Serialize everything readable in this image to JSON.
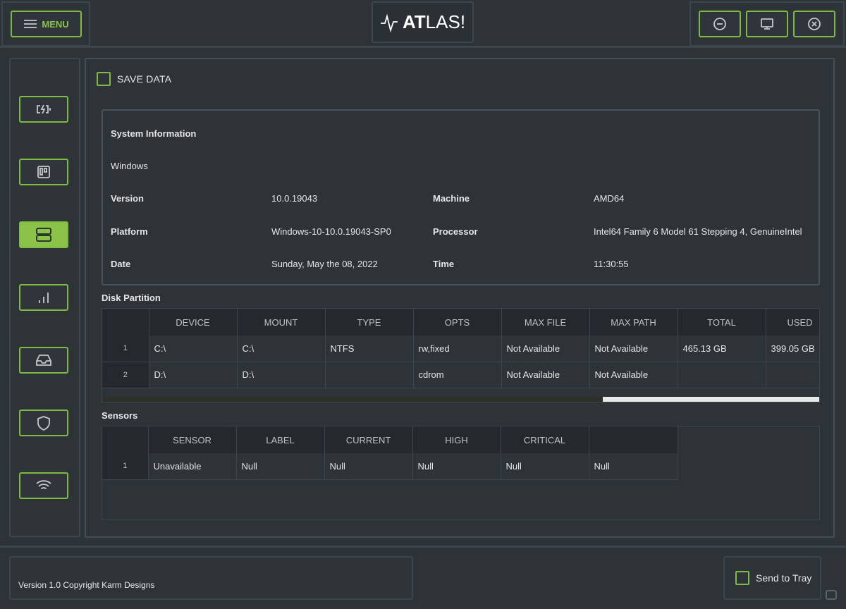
{
  "header": {
    "menu_label": "MENU",
    "logo_bold": "AT",
    "logo_rest": "LAS!"
  },
  "sidebar": {
    "items": [
      {
        "icon": "battery-icon"
      },
      {
        "icon": "board-icon"
      },
      {
        "icon": "server-icon",
        "active": true
      },
      {
        "icon": "bar-chart-icon"
      },
      {
        "icon": "inbox-icon"
      },
      {
        "icon": "shield-icon"
      },
      {
        "icon": "wifi-icon"
      }
    ]
  },
  "main": {
    "save_data_label": "SAVE DATA",
    "sysinfo": {
      "title": "System Information",
      "os": "Windows",
      "version_label": "Version",
      "version_value": "10.0.19043",
      "machine_label": "Machine",
      "machine_value": "AMD64",
      "platform_label": "Platform",
      "platform_value": "Windows-10-10.0.19043-SP0",
      "processor_label": "Processor",
      "processor_value": "Intel64 Family 6 Model 61 Stepping 4, GenuineIntel",
      "date_label": "Date",
      "date_value": "Sunday, May the 08, 2022",
      "time_label": "Time",
      "time_value": "11:30:55"
    },
    "disk": {
      "title": "Disk Partition",
      "columns": [
        "DEVICE",
        "MOUNT",
        "TYPE",
        "OPTS",
        "MAX FILE",
        "MAX PATH",
        "TOTAL",
        "USED"
      ],
      "rows": [
        {
          "index": "1",
          "cells": [
            "C:\\",
            "C:\\",
            "NTFS",
            "rw,fixed",
            "Not Available",
            "Not Available",
            "465.13 GB",
            "399.05 GB"
          ]
        },
        {
          "index": "2",
          "cells": [
            "D:\\",
            "D:\\",
            "",
            "cdrom",
            "Not Available",
            "Not Available",
            "",
            ""
          ]
        }
      ]
    },
    "sensors": {
      "title": "Sensors",
      "columns": [
        "SENSOR",
        "LABEL",
        "CURRENT",
        "HIGH",
        "CRITICAL",
        ""
      ],
      "rows": [
        {
          "index": "1",
          "cells": [
            "Unavailable",
            "Null",
            "Null",
            "Null",
            "Null",
            "Null"
          ]
        }
      ]
    }
  },
  "footer": {
    "version_text": "Version 1.0 Copyright Karm Designs",
    "tray_label": "Send to Tray"
  },
  "colors": {
    "accent": "#8bc34a",
    "background": "#2e3338",
    "border": "#3d454d"
  }
}
